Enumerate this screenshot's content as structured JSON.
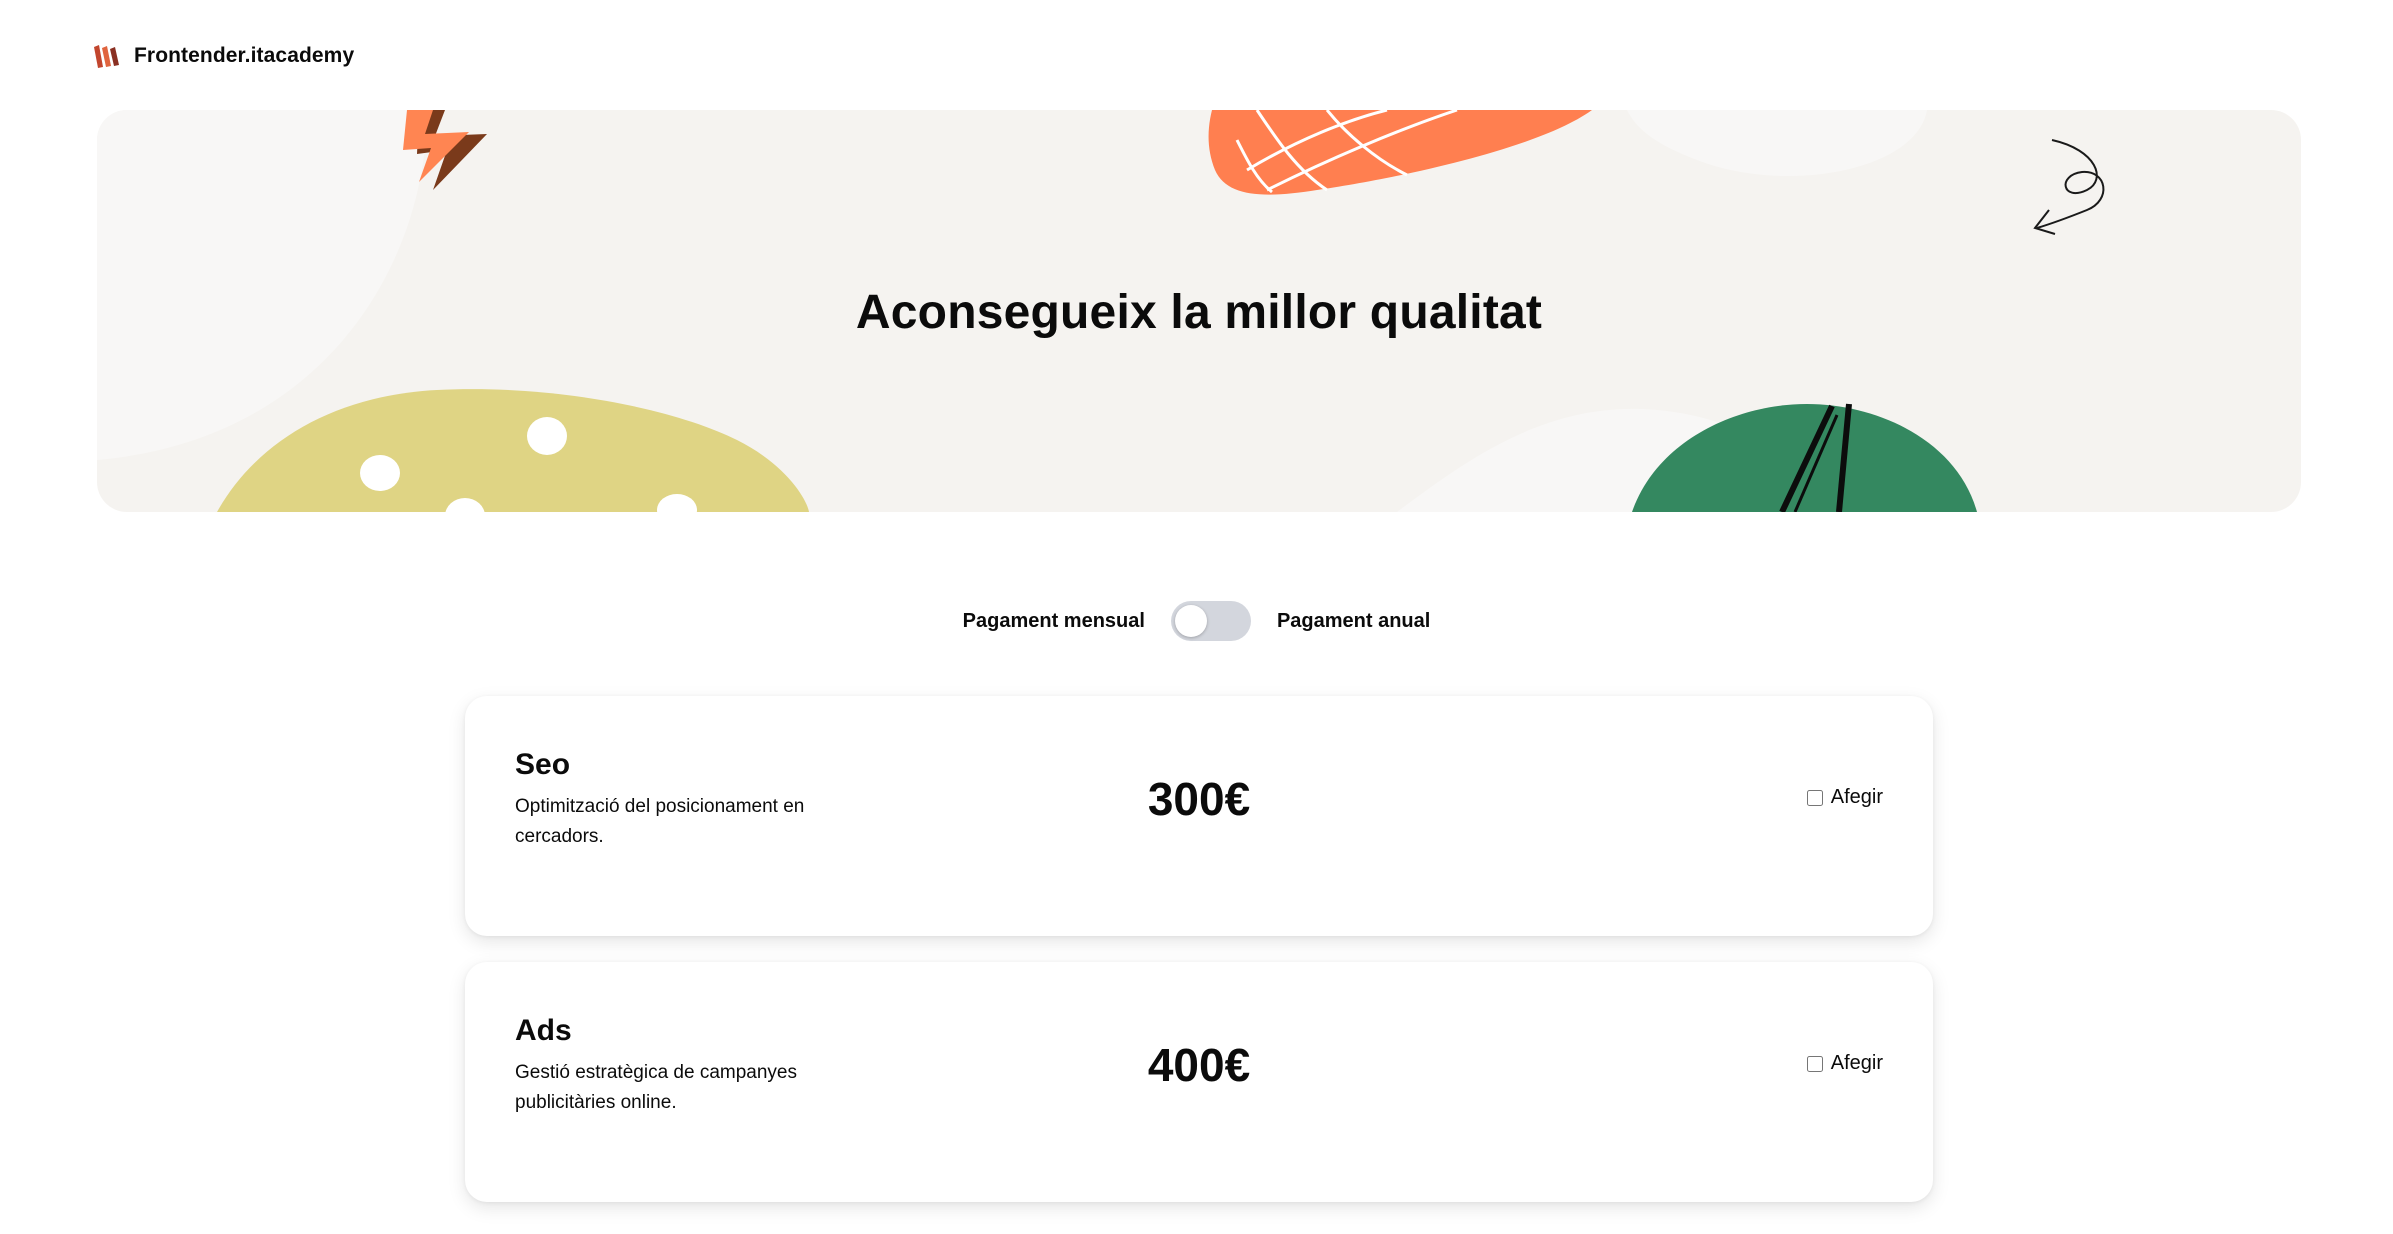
{
  "header": {
    "brand": "Frontender.itacademy",
    "logo_icon": "itacademy-logo-icon"
  },
  "hero": {
    "title": "Aconsegueix la millor qualitat",
    "background": "#f5f3f0",
    "decorations": [
      "lightning-icon",
      "orange-blob",
      "swirl-arrow-icon",
      "yellow-blob",
      "green-leaf-blob"
    ]
  },
  "billing": {
    "monthly_label": "Pagament mensual",
    "annual_label": "Pagament anual",
    "annual_selected": false
  },
  "services": [
    {
      "name": "Seo",
      "description": "Optimització del posicionament en cercadors.",
      "price": "300€",
      "add_label": "Afegir",
      "checked": false
    },
    {
      "name": "Ads",
      "description": "Gestió estratègica de campanyes publicitàries online.",
      "price": "400€",
      "add_label": "Afegir",
      "checked": false
    }
  ],
  "colors": {
    "orange": "#ff7f50",
    "yellow": "#dfd484",
    "green": "#348860",
    "toggle_track": "#d3d6dd",
    "logo_red": "#c2452d"
  }
}
